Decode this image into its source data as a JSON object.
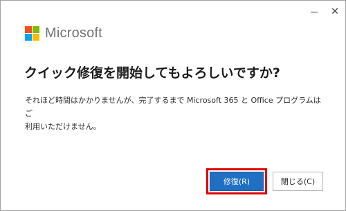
{
  "window": {
    "minimize_symbol": "",
    "close_symbol": "✕"
  },
  "logo": {
    "brand": "Microsoft",
    "colors": [
      "#F25022",
      "#7FBA00",
      "#00A4EF",
      "#FFB900"
    ]
  },
  "dialog": {
    "heading": "クイック修復を開始してもよろしいですか?",
    "body_line1": "それほど時間はかかりませんが、完了するまで Microsoft 365 と Office プログラムはご",
    "body_line2": "利用いただけません。"
  },
  "buttons": {
    "repair_label": "修復(R)",
    "close_label": "閉じる(C)"
  },
  "colors": {
    "accent": "#1F6FC2",
    "highlight": "#E00000"
  }
}
